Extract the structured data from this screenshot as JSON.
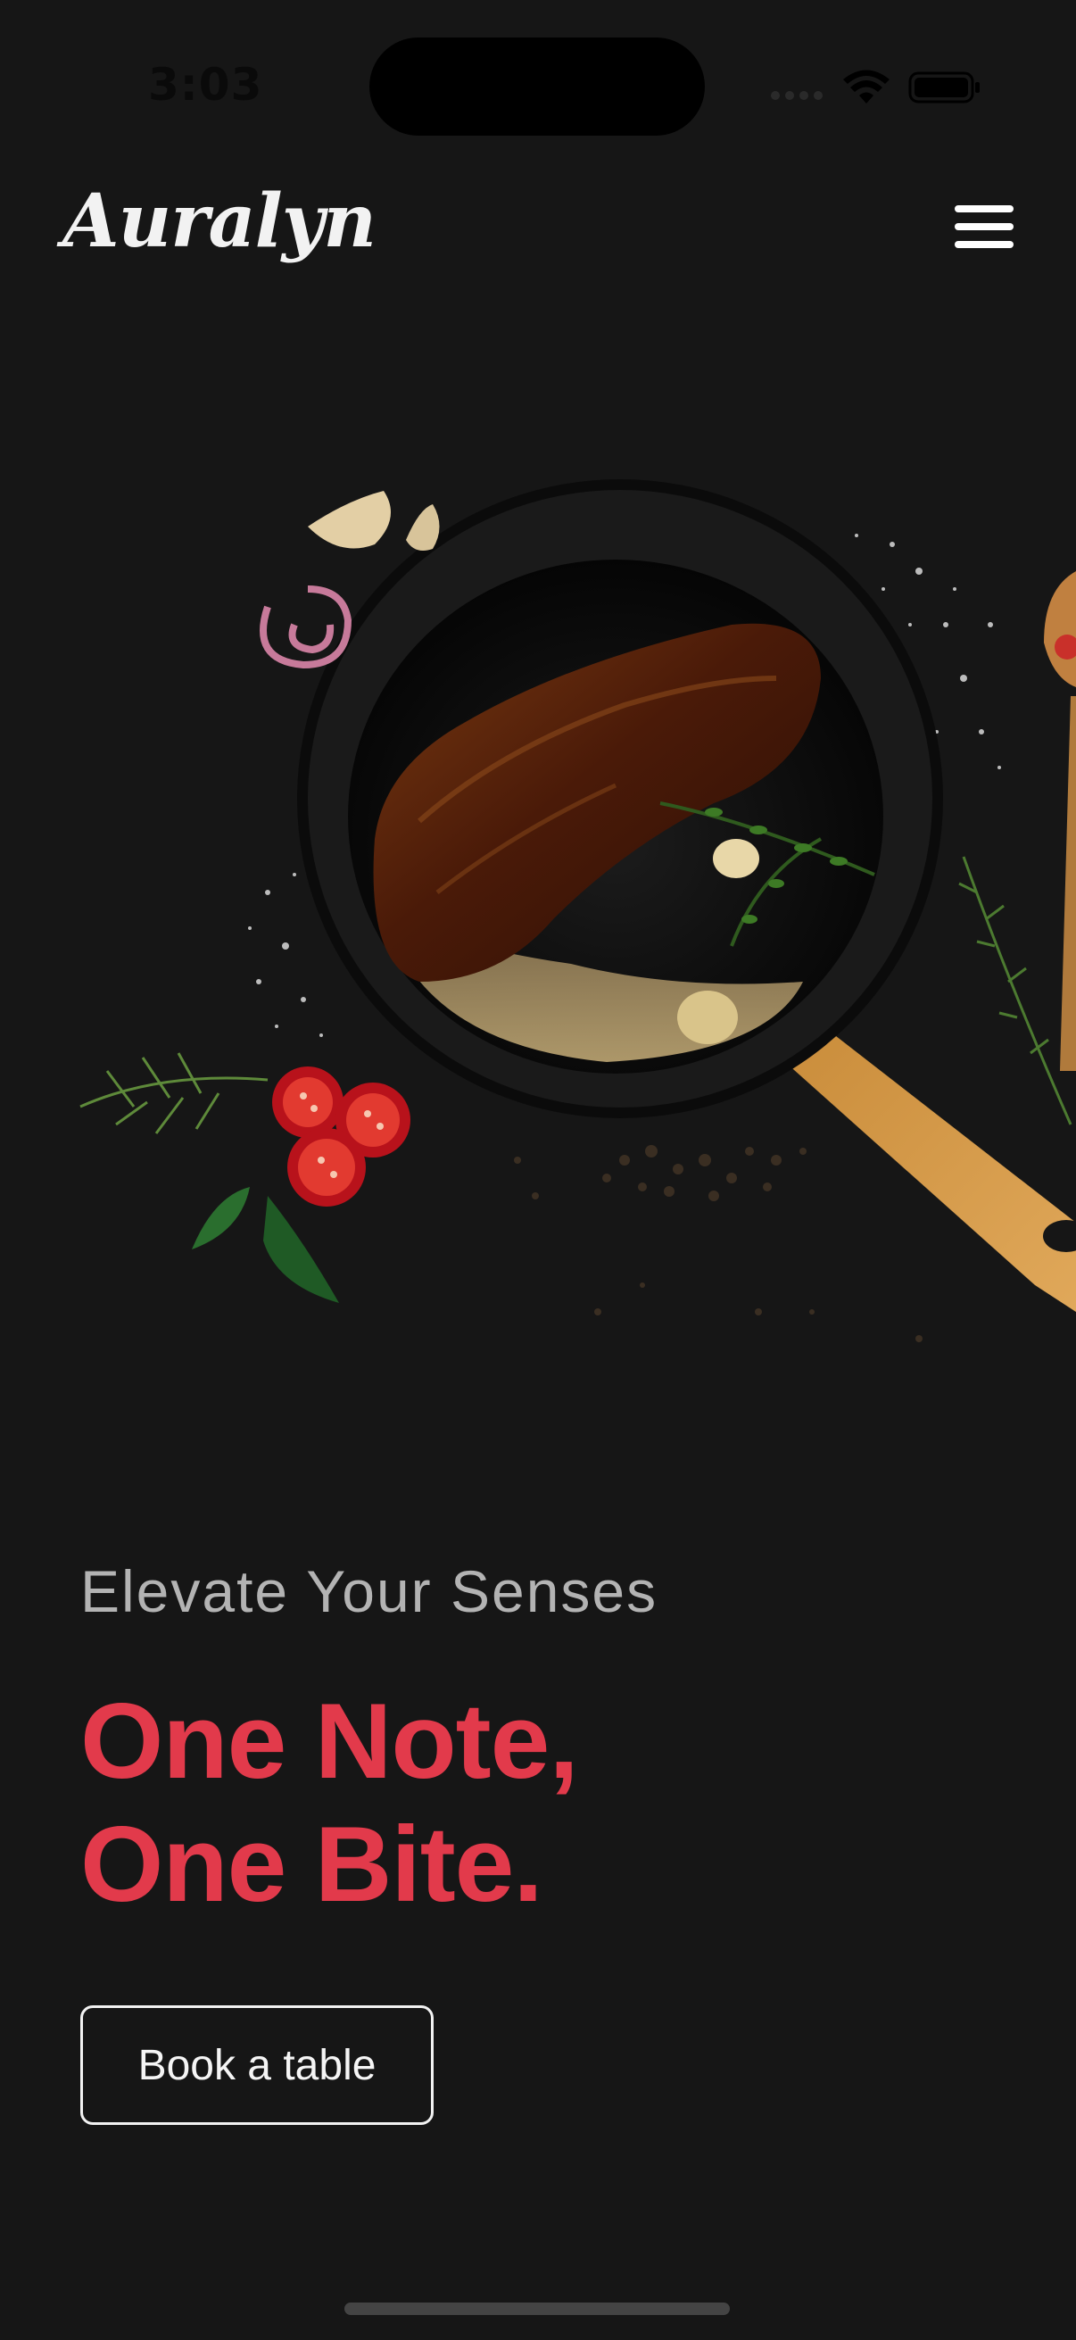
{
  "status_bar": {
    "time": "3:03"
  },
  "header": {
    "logo": "Auralyn",
    "menu_icon": "hamburger-menu-icon"
  },
  "hero": {
    "image": "cast-iron-pan-with-seared-steak-and-ingredients",
    "tagline": "Elevate Your Senses",
    "headline_line1": "One Note,",
    "headline_line2": "One Bite.",
    "cta_label": "Book a table"
  },
  "colors": {
    "background": "#161616",
    "accent": "#e23a4b",
    "tagline": "#b3b3b3",
    "text": "#f2f2f2"
  }
}
